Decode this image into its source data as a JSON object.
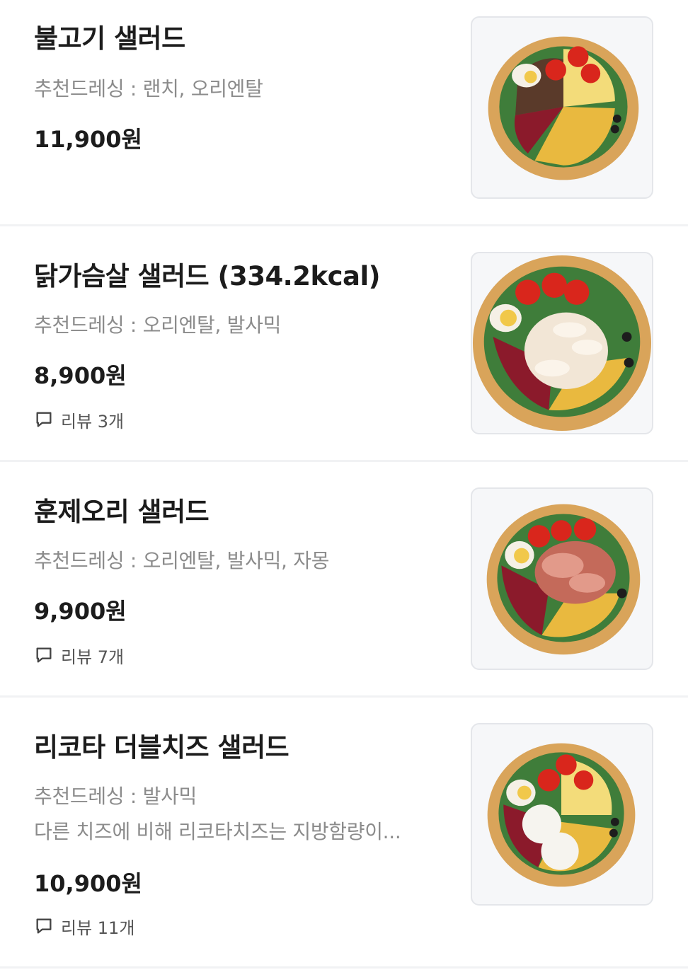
{
  "menu": {
    "items": [
      {
        "title": "불고기 샐러드",
        "dressing": "추천드레싱 : 랜치, 오리엔탈",
        "price": "11,900원",
        "image": "bulgogi-salad-bowl"
      },
      {
        "title": "닭가슴살 샐러드 (334.2kcal)",
        "dressing": "추천드레싱 : 오리엔탈, 발사믹",
        "price": "8,900원",
        "review": "리뷰 3개",
        "image": "chicken-breast-salad-bowl"
      },
      {
        "title": "훈제오리 샐러드",
        "dressing": "추천드레싱 : 오리엔탈, 발사믹, 자몽",
        "price": "9,900원",
        "review": "리뷰 7개",
        "image": "smoked-duck-salad-bowl"
      },
      {
        "title": "리코타 더블치즈 샐러드",
        "dressing": "추천드레싱 : 발사믹",
        "description": "다른 치즈에 비해 리코타치즈는 지방함량이...",
        "price": "10,900원",
        "review": "리뷰 11개",
        "image": "ricotta-double-cheese-salad-bowl"
      }
    ]
  },
  "icons": {
    "review": "speech-bubble-icon"
  },
  "colors": {
    "title": "#1c1c1c",
    "subtext": "#8b8b8b",
    "divider": "#f1f2f4",
    "thumb_border": "#e4e6ea"
  }
}
